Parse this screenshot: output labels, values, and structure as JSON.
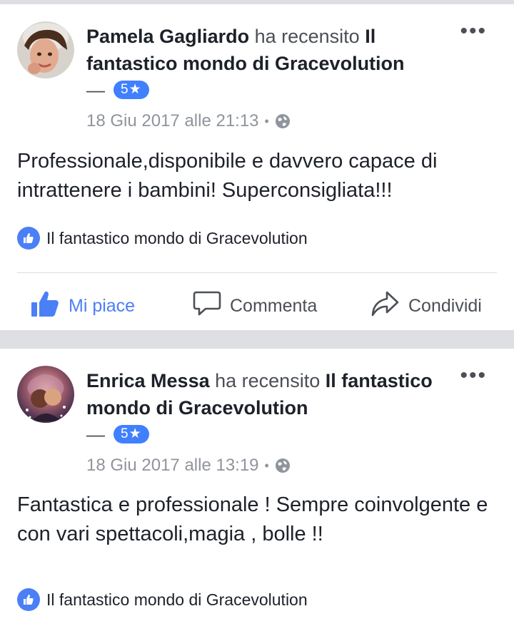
{
  "posts": [
    {
      "author": "Pamela Gagliardo",
      "verb": "ha recensito",
      "page": "Il fantastico mondo di Gracevolution",
      "dash": "—",
      "rating": "5★",
      "timestamp": "18 Giu 2017 alle 21:13",
      "separator": "•",
      "body": "Professionale,disponibile e davvero capace di intrattenere i bambini! Superconsigliata!!!",
      "liked_by": "Il fantastico mondo di Gracevolution",
      "more": "•••"
    },
    {
      "author": "Enrica Messa",
      "verb": "ha recensito",
      "page": "Il fantastico mondo di Gracevolution",
      "dash": "—",
      "rating": "5★",
      "timestamp": "18 Giu 2017 alle 13:19",
      "separator": "•",
      "body": "Fantastica e professionale ! Sempre coinvolgente e con vari spettacoli,magia , bolle !!",
      "liked_by": "Il fantastico mondo di Gracevolution",
      "more": "•••"
    }
  ],
  "actions": {
    "like": "Mi piace",
    "comment": "Commenta",
    "share": "Condividi"
  },
  "colors": {
    "accent": "#4a7ff6",
    "badge": "#4080ff",
    "meta": "#90949c",
    "separator_bg": "#dddfe2"
  },
  "icons": [
    "globe-icon",
    "like-thumb-icon",
    "comment-icon",
    "share-icon",
    "more-icon"
  ]
}
